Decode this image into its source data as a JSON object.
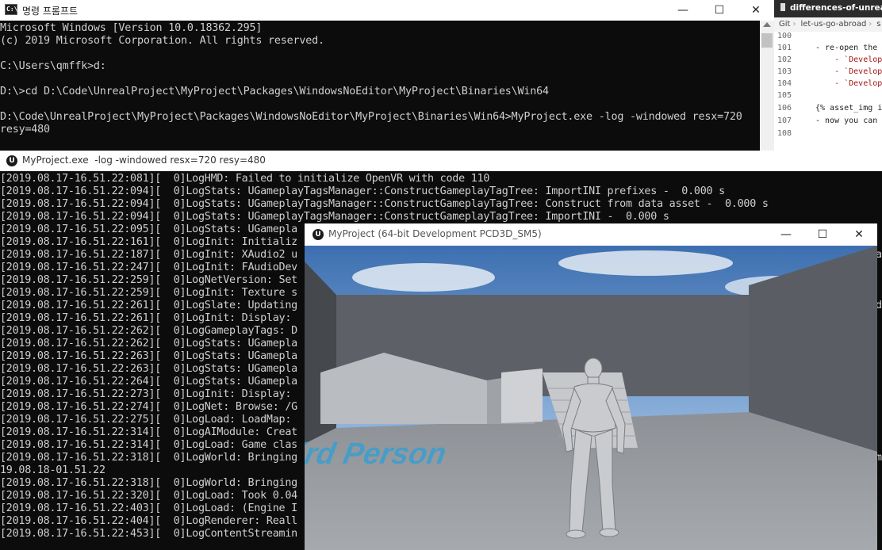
{
  "cmd": {
    "title": "명령 프롬프트",
    "icon_text": "C:\\",
    "lines": [
      "Microsoft Windows [Version 10.0.18362.295]",
      "(c) 2019 Microsoft Corporation. All rights reserved.",
      "",
      "C:\\Users\\qmffk>d:",
      "",
      "D:\\>cd D:\\Code\\UnrealProject\\MyProject\\Packages\\WindowsNoEditor\\MyProject\\Binaries\\Win64",
      "",
      "D:\\Code\\UnrealProject\\MyProject\\Packages\\WindowsNoEditor\\MyProject\\Binaries\\Win64>MyProject.exe -log -windowed resx=720",
      "resy=480"
    ]
  },
  "vscode": {
    "tab_title": "differences-of-unreal-bu",
    "breadcrumb": [
      "Git",
      "let-us-go-abroad",
      "s"
    ],
    "lines": [
      {
        "num": "100",
        "text": "",
        "cls": ""
      },
      {
        "num": "101",
        "text": "- re-open the",
        "cls": ""
      },
      {
        "num": "102",
        "text": "    - `Develop",
        "cls": "str"
      },
      {
        "num": "103",
        "text": "    - `Develop",
        "cls": "str"
      },
      {
        "num": "104",
        "text": "    - `Develop",
        "cls": "str"
      },
      {
        "num": "105",
        "text": "",
        "cls": ""
      },
      {
        "num": "106",
        "text": "{% asset_img i",
        "cls": ""
      },
      {
        "num": "107",
        "text": "- now you can",
        "cls": ""
      },
      {
        "num": "108",
        "text": "",
        "cls": ""
      }
    ]
  },
  "log": {
    "title": "MyProject.exe  -log -windowed resx=720 resy=480",
    "lines": [
      "[2019.08.17-16.51.22:081][  0]LogHMD: Failed to initialize OpenVR with code 110",
      "[2019.08.17-16.51.22:094][  0]LogStats: UGameplayTagsManager::ConstructGameplayTagTree: ImportINI prefixes -  0.000 s",
      "[2019.08.17-16.51.22:094][  0]LogStats: UGameplayTagsManager::ConstructGameplayTagTree: Construct from data asset -  0.000 s",
      "[2019.08.17-16.51.22:094][  0]LogStats: UGameplayTagsManager::ConstructGameplayTagTree: ImportINI -  0.000 s",
      "[2019.08.17-16.51.22:095][  0]LogStats: UGamepla",
      "[2019.08.17-16.51.22:161][  0]LogInit: Initializ",
      "[2019.08.17-16.51.22:187][  0]LogInit: XAudio2 u",
      "[2019.08.17-16.51.22:247][  0]LogInit: FAudioDev",
      "[2019.08.17-16.51.22:259][  0]LogNetVersion: Set",
      "[2019.08.17-16.51.22:259][  0]LogInit: Texture s",
      "[2019.08.17-16.51.22:261][  0]LogSlate: Updating",
      "[2019.08.17-16.51.22:261][  0]LogInit: Display: ",
      "[2019.08.17-16.51.22:262][  0]LogGameplayTags: D",
      "[2019.08.17-16.51.22:262][  0]LogStats: UGamepla",
      "[2019.08.17-16.51.22:263][  0]LogStats: UGamepla",
      "[2019.08.17-16.51.22:263][  0]LogStats: UGamepla",
      "[2019.08.17-16.51.22:264][  0]LogStats: UGamepla",
      "[2019.08.17-16.51.22:273][  0]LogInit: Display: ",
      "[2019.08.17-16.51.22:274][  0]LogNet: Browse: /G",
      "[2019.08.17-16.51.22:275][  0]LogLoad: LoadMap: ",
      "[2019.08.17-16.51.22:314][  0]LogAIModule: Creat",
      "[2019.08.17-16.51.22:314][  0]LogLoad: Game clas",
      "[2019.08.17-16.51.22:318][  0]LogWorld: Bringing",
      "19.08.18-01.51.22",
      "[2019.08.17-16.51.22:318][  0]LogWorld: Bringing",
      "[2019.08.17-16.51.22:320][  0]LogLoad: Took 0.04",
      "[2019.08.17-16.51.22:403][  0]LogLoad: (Engine I",
      "[2019.08.17-16.51.22:404][  0]LogRenderer: Reall",
      "[2019.08.17-16.51.22:453][  0]LogContentStreamin"
    ],
    "right_edge": [
      "a",
      "d",
      "m"
    ]
  },
  "game": {
    "title": "MyProject (64-bit Development PCD3D_SM5)",
    "floor_text": "Third Person"
  },
  "window_controls": {
    "minimize": "—",
    "maximize": "☐",
    "close": "✕"
  }
}
